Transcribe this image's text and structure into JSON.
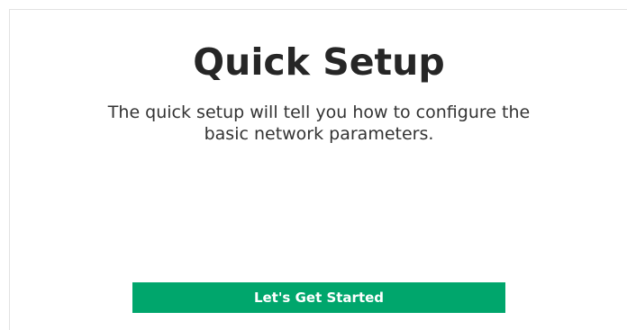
{
  "setup": {
    "title": "Quick Setup",
    "description": "The quick setup will tell you how to configure the basic network parameters.",
    "start_button_label": "Let's Get Started"
  },
  "colors": {
    "accent": "#00a66c",
    "title_text": "#262626",
    "body_text": "#333333",
    "background": "#ffffff",
    "panel_border": "#e2e2e2"
  }
}
